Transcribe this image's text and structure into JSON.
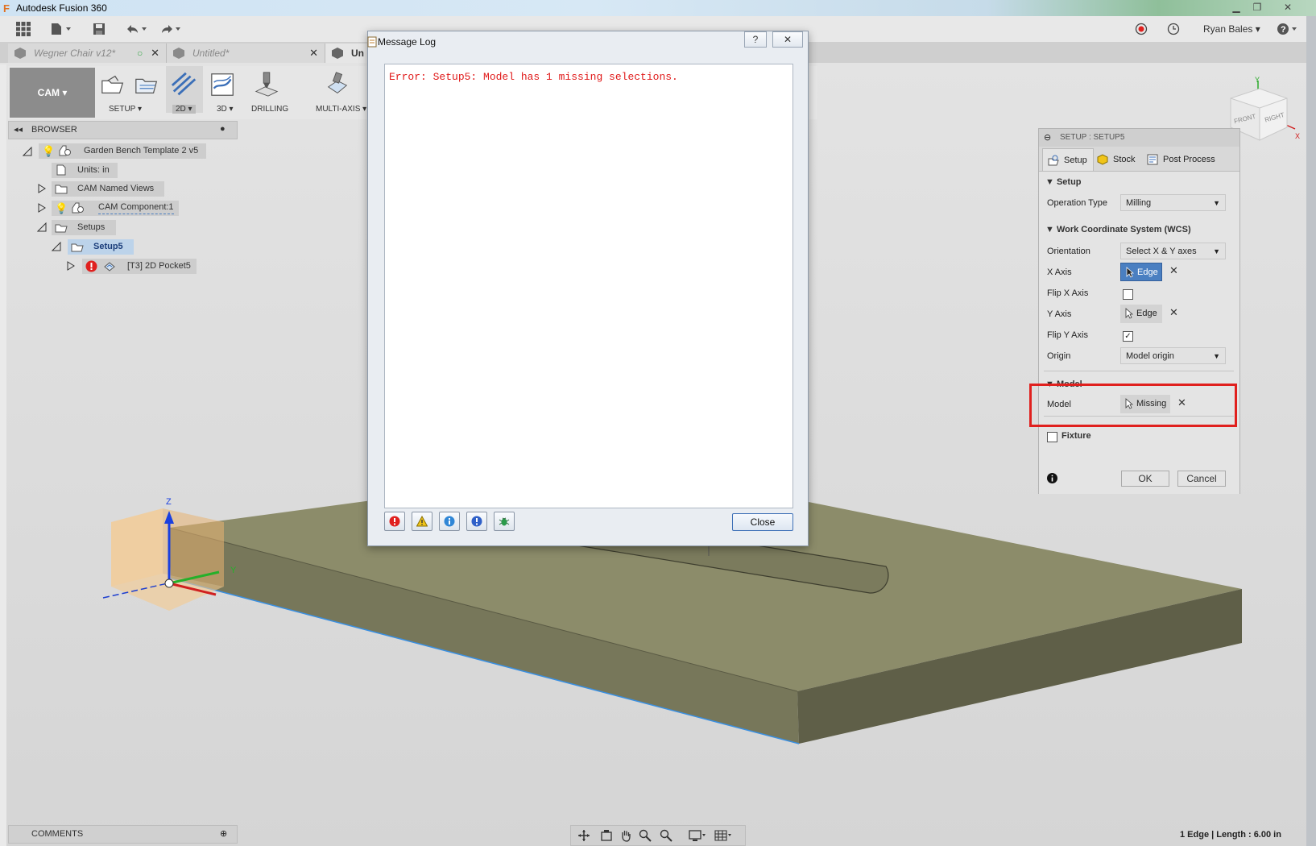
{
  "window": {
    "title": "Autodesk Fusion 360",
    "app_icon": "F"
  },
  "toolbar": {
    "user": "Ryan Bales",
    "help": "?"
  },
  "tabs": [
    {
      "label": "Wegner Chair v12*"
    },
    {
      "label": "Untitled*"
    },
    {
      "label": "Un"
    }
  ],
  "ribbon": {
    "workspace": "CAM ▾",
    "groups": [
      {
        "label": "SETUP ▾"
      },
      {
        "label": "2D ▾"
      },
      {
        "label": "3D ▾"
      },
      {
        "label": "DRILLING"
      },
      {
        "label": "MULTI-AXIS ▾"
      }
    ]
  },
  "browser": {
    "title": "BROWSER",
    "items": [
      {
        "label": "Garden Bench Template 2 v5"
      },
      {
        "label": "Units: in"
      },
      {
        "label": "CAM Named Views"
      },
      {
        "label": "CAM Component:1"
      },
      {
        "label": "Setups"
      },
      {
        "label": "Setup5"
      },
      {
        "label": "[T3] 2D Pocket5"
      }
    ]
  },
  "message_log": {
    "title": "Message Log",
    "help_label": "?",
    "close_x": "✕",
    "error_text": "Error: Setup5: Model has 1 missing selections.",
    "close_label": "Close"
  },
  "setup_panel": {
    "title": "SETUP : SETUP5",
    "tabs": [
      {
        "label": "Setup"
      },
      {
        "label": "Stock"
      },
      {
        "label": "Post Process"
      }
    ],
    "section_setup": "Setup",
    "operation_type_label": "Operation Type",
    "operation_type_value": "Milling",
    "section_wcs": "Work Coordinate System (WCS)",
    "orientation_label": "Orientation",
    "orientation_value": "Select X & Y axes",
    "x_axis_label": "X Axis",
    "x_axis_value": "Edge",
    "flip_x_label": "Flip X Axis",
    "flip_x_checked": false,
    "y_axis_label": "Y Axis",
    "y_axis_value": "Edge",
    "flip_y_label": "Flip Y Axis",
    "flip_y_checked": true,
    "origin_label": "Origin",
    "origin_value": "Model origin",
    "section_model": "Model",
    "model_label": "Model",
    "model_value": "Missing",
    "fixture_label": "Fixture",
    "ok_label": "OK",
    "cancel_label": "Cancel"
  },
  "viewcube": {
    "front": "FRONT",
    "right": "RIGHT",
    "x": "X",
    "y": "Y"
  },
  "origin_triad": {
    "z": "Z",
    "y": "Y"
  },
  "bottom": {
    "comments": "COMMENTS",
    "status": "1 Edge | Length : 6.00 in"
  },
  "colors": {
    "highlight_box": "#e0201e",
    "selection_blue": "#4a7fc1",
    "error_red": "#e01a1a",
    "part_color": "#8c8c6a"
  }
}
